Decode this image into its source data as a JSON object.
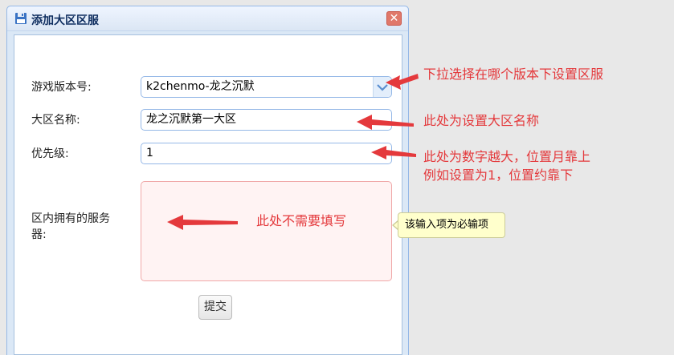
{
  "dialog": {
    "title": "添加大区区服",
    "close_icon": "close-icon",
    "title_icon": "save-icon"
  },
  "form": {
    "version_label": "游戏版本号:",
    "version_value": "k2chenmo-龙之沉默",
    "region_label": "大区名称:",
    "region_value": "龙之沉默第一大区",
    "priority_label": "优先级:",
    "priority_value": "1",
    "servers_label_line1": "区内拥有的服务",
    "servers_label_line2": "器:",
    "servers_value": "",
    "submit_label": "提交"
  },
  "tooltip": {
    "text": "该输入项为必输项"
  },
  "annotations": {
    "version_note": "下拉选择在哪个版本下设置区服",
    "region_note": "此处为设置大区名称",
    "priority_note_line1": "此处为数字越大，位置月靠上",
    "priority_note_line2": "例如设置为1，位置约靠下",
    "servers_note": "此处不需要填写",
    "color": "#e4393c"
  }
}
